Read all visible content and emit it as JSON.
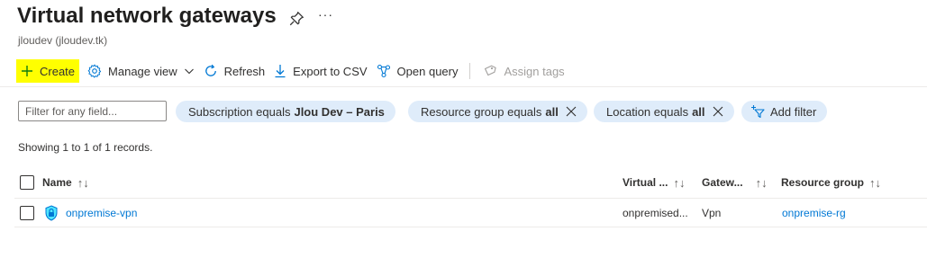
{
  "page": {
    "title": "Virtual network gateways",
    "subtitle": "jloudev (jloudev.tk)",
    "more_label": "···"
  },
  "toolbar": {
    "create_label": "Create",
    "manage_view_label": "Manage view",
    "refresh_label": "Refresh",
    "export_label": "Export to CSV",
    "open_query_label": "Open query",
    "assign_tags_label": "Assign tags",
    "highlight_color": "#ffff00"
  },
  "filters": {
    "search_placeholder": "Filter for any field...",
    "pills": [
      {
        "prefix": "Subscription equals",
        "value": "Jlou Dev – Paris",
        "removable": false
      },
      {
        "prefix": "Resource group equals",
        "value": "all",
        "removable": true
      },
      {
        "prefix": "Location equals",
        "value": "all",
        "removable": true
      }
    ],
    "add_filter_label": "Add filter"
  },
  "records_text": "Showing 1 to 1 of 1 records.",
  "table": {
    "columns": [
      "Name",
      "Virtual ...",
      "Gatew...",
      "Resource group"
    ],
    "sort_glyph": "↑↓",
    "rows": [
      {
        "name": "onpremise-vpn",
        "virtual_network": "onpremised...",
        "gateway_type": "Vpn",
        "resource_group": "onpremise-rg"
      }
    ]
  },
  "colors": {
    "link": "#0078d4",
    "pill": "#dfecfa",
    "accent": "#0078d4"
  }
}
